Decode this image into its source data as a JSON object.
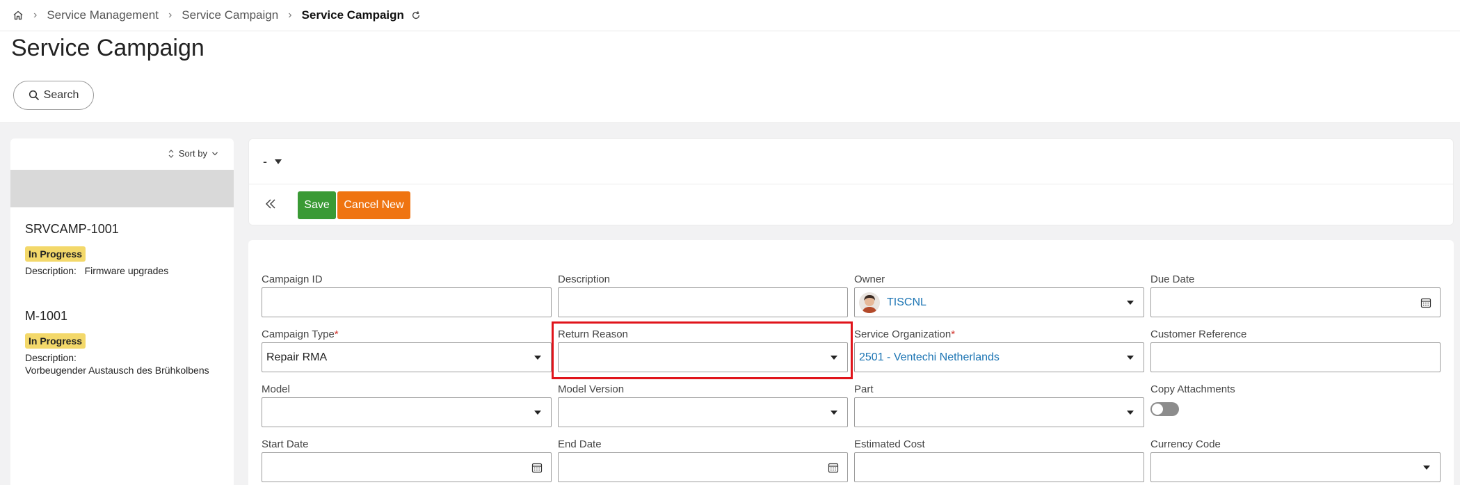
{
  "breadcrumb": {
    "items": [
      "Service Management",
      "Service Campaign",
      "Service Campaign"
    ]
  },
  "header": {
    "title": "Service Campaign",
    "search_label": "Search"
  },
  "list": {
    "sort_label": "Sort by",
    "items": [
      {
        "title": "SRVCAMP-1001",
        "status": "In Progress",
        "desc_label": "Description:",
        "desc_value": "Firmware upgrades"
      },
      {
        "title": "M-1001",
        "status": "In Progress",
        "desc_label": "Description:",
        "desc_value": "Vorbeugender Austausch des Brühkolbens"
      }
    ]
  },
  "record": {
    "title": "-",
    "save_label": "Save",
    "cancel_label": "Cancel New"
  },
  "form": {
    "campaign_id": {
      "label": "Campaign ID",
      "value": ""
    },
    "description": {
      "label": "Description",
      "value": ""
    },
    "owner": {
      "label": "Owner",
      "value": "TISCNL"
    },
    "due_date": {
      "label": "Due Date",
      "value": ""
    },
    "campaign_type": {
      "label": "Campaign Type",
      "value": "Repair RMA",
      "required": "*"
    },
    "return_reason": {
      "label": "Return Reason",
      "value": ""
    },
    "service_org": {
      "label": "Service Organization",
      "value": "2501 - Ventechi Netherlands",
      "required": "*"
    },
    "customer_ref": {
      "label": "Customer Reference",
      "value": ""
    },
    "model": {
      "label": "Model",
      "value": ""
    },
    "model_version": {
      "label": "Model Version",
      "value": ""
    },
    "part": {
      "label": "Part",
      "value": ""
    },
    "copy_attachments": {
      "label": "Copy Attachments",
      "value": false
    },
    "start_date": {
      "label": "Start Date",
      "value": ""
    },
    "end_date": {
      "label": "End Date",
      "value": ""
    },
    "estimated_cost": {
      "label": "Estimated Cost",
      "value": ""
    },
    "currency_code": {
      "label": "Currency Code",
      "value": ""
    }
  },
  "colors": {
    "save": "#3a9a35",
    "cancel": "#ef7411",
    "badge": "#f3d86a",
    "link": "#1b74b3",
    "highlight": "#e0141b"
  }
}
